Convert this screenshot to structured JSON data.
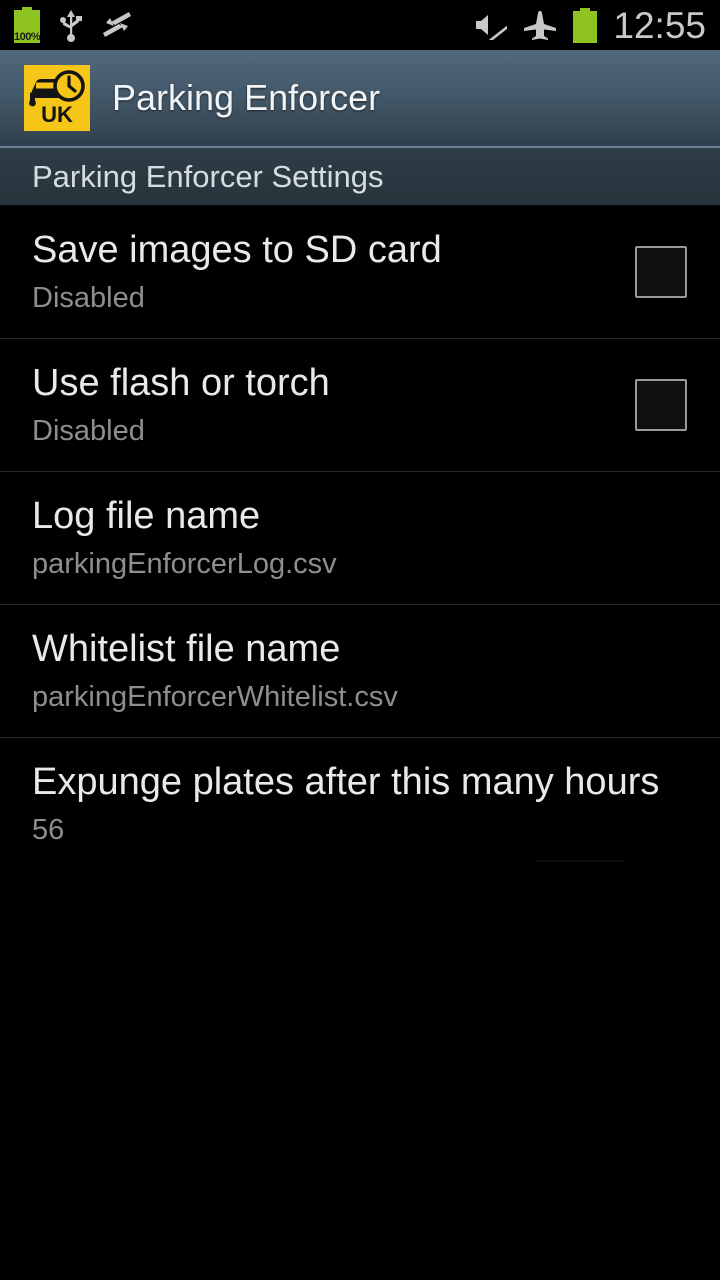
{
  "statusbar": {
    "battery_percent_label": "100%",
    "left_icons": [
      "battery-charging-icon",
      "usb-icon",
      "data-transfer-icon"
    ],
    "right_icons": [
      "sound-muted-icon",
      "airplane-mode-icon",
      "battery-icon"
    ],
    "time": "12:55"
  },
  "actionbar": {
    "app_icon_name": "parking-enforcer-app-icon",
    "app_icon_text": "UK",
    "app_icon_color": "#f5c518",
    "title": "Parking Enforcer"
  },
  "subheader": {
    "title": "Parking Enforcer Settings"
  },
  "settings": {
    "rows": [
      {
        "title": "Save images to SD card",
        "summary": "Disabled",
        "widget": "checkbox",
        "checked": false
      },
      {
        "title": "Use flash or torch",
        "summary": "Disabled",
        "widget": "checkbox",
        "checked": false
      },
      {
        "title": "Log file name",
        "summary": "parkingEnforcerLog.csv",
        "widget": "none"
      },
      {
        "title": "Whitelist file name",
        "summary": "parkingEnforcerWhitelist.csv",
        "widget": "none"
      },
      {
        "title": "Expunge plates after this many hours",
        "summary": "56",
        "widget": "none",
        "clipped": true
      }
    ]
  }
}
